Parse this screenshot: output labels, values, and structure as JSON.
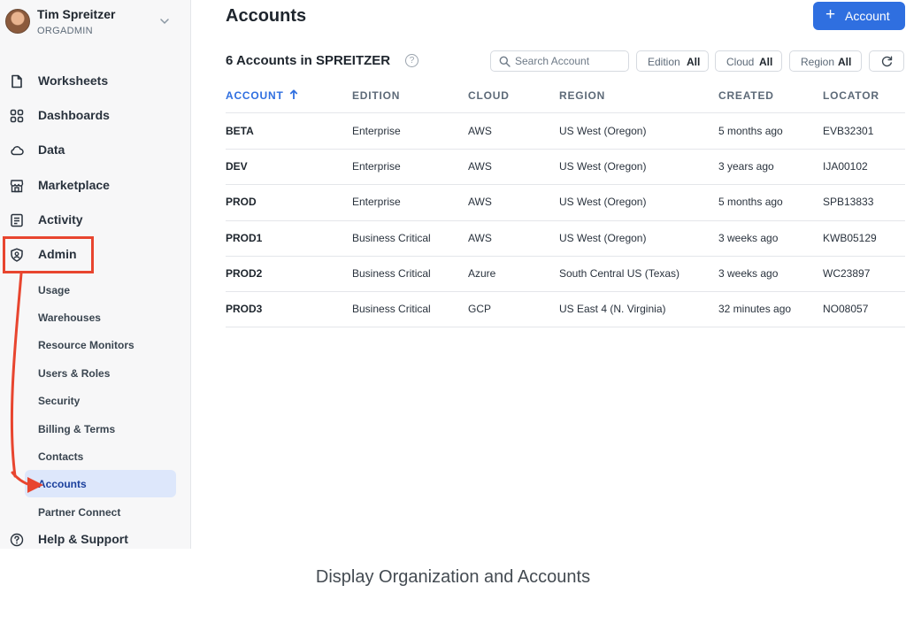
{
  "user": {
    "name": "Tim Spreitzer",
    "role": "ORGADMIN"
  },
  "sidebar": {
    "items": [
      {
        "label": "Worksheets",
        "icon": "worksheet-icon"
      },
      {
        "label": "Dashboards",
        "icon": "dashboard-grid-icon"
      },
      {
        "label": "Data",
        "icon": "cloud-icon"
      },
      {
        "label": "Marketplace",
        "icon": "storefront-icon"
      },
      {
        "label": "Activity",
        "icon": "activity-list-icon"
      },
      {
        "label": "Admin",
        "icon": "admin-shield-icon"
      }
    ],
    "admin_sub": [
      {
        "label": "Usage"
      },
      {
        "label": "Warehouses"
      },
      {
        "label": "Resource Monitors"
      },
      {
        "label": "Users & Roles"
      },
      {
        "label": "Security"
      },
      {
        "label": "Billing & Terms"
      },
      {
        "label": "Contacts"
      },
      {
        "label": "Accounts",
        "active": true
      },
      {
        "label": "Partner Connect"
      }
    ],
    "help": {
      "label": "Help & Support",
      "icon": "help-circle-icon"
    }
  },
  "main": {
    "title": "Accounts",
    "add_button": {
      "plus": "+",
      "label": "Account"
    },
    "count_label": "6 Accounts in SPREITZER",
    "search": {
      "placeholder": "Search Account"
    },
    "filters": [
      {
        "key": "Edition",
        "value": "All"
      },
      {
        "key": "Cloud",
        "value": "All"
      },
      {
        "key": "Region",
        "value": "All"
      }
    ],
    "columns": [
      "ACCOUNT",
      "EDITION",
      "CLOUD",
      "REGION",
      "CREATED",
      "LOCATOR"
    ],
    "sorted_column": "ACCOUNT",
    "rows": [
      {
        "account": "BETA",
        "edition": "Enterprise",
        "cloud": "AWS",
        "region": "US West (Oregon)",
        "created": "5 months ago",
        "locator": "EVB32301"
      },
      {
        "account": "DEV",
        "edition": "Enterprise",
        "cloud": "AWS",
        "region": "US West (Oregon)",
        "created": "3 years ago",
        "locator": "IJA00102"
      },
      {
        "account": "PROD",
        "edition": "Enterprise",
        "cloud": "AWS",
        "region": "US West (Oregon)",
        "created": "5 months ago",
        "locator": "SPB13833"
      },
      {
        "account": "PROD1",
        "edition": "Business Critical",
        "cloud": "AWS",
        "region": "US West (Oregon)",
        "created": "3 weeks ago",
        "locator": "KWB05129"
      },
      {
        "account": "PROD2",
        "edition": "Business Critical",
        "cloud": "Azure",
        "region": "South Central US (Texas)",
        "created": "3 weeks ago",
        "locator": "WC23897"
      },
      {
        "account": "PROD3",
        "edition": "Business Critical",
        "cloud": "GCP",
        "region": "US East 4 (N. Virginia)",
        "created": "32 minutes ago",
        "locator": "NO08057"
      }
    ]
  },
  "caption": "Display Organization and Accounts",
  "colors": {
    "accent": "#2f6fe0",
    "annotation": "#e8452f",
    "active_bg": "#dde7fb"
  }
}
